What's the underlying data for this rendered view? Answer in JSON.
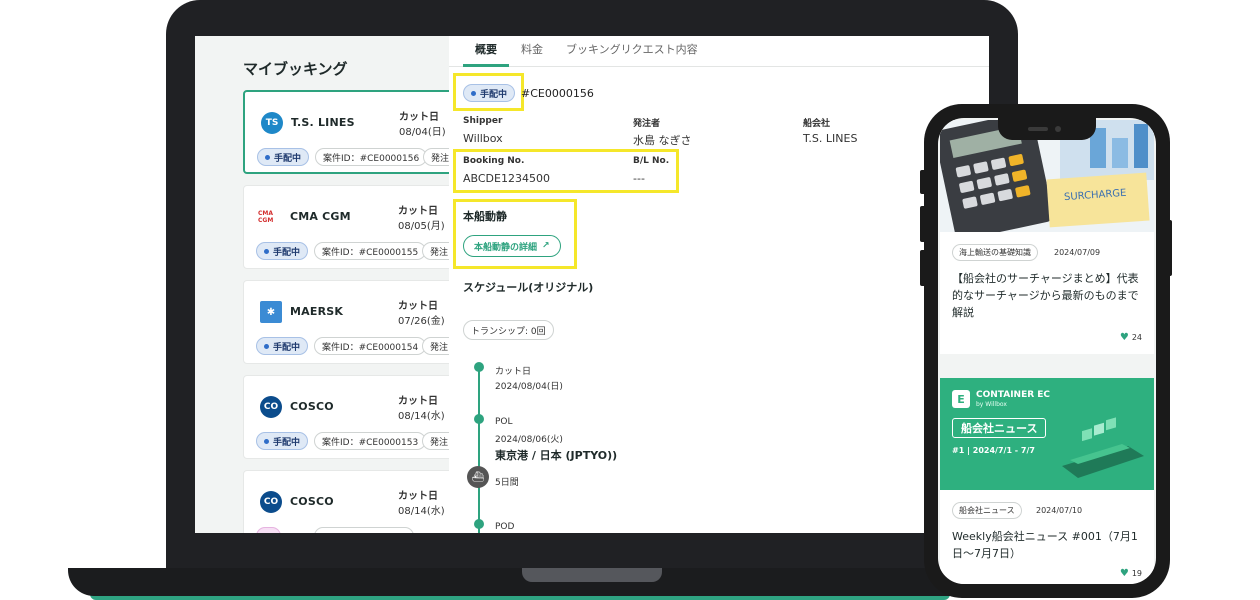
{
  "list": {
    "title": "マイブッキング",
    "cut_label": "カット日",
    "status_label": "手配中",
    "more_chip": "発注",
    "cards": [
      {
        "logo": "TS",
        "name": "T.S. LINES",
        "cut_date": "08/04(日)",
        "case_id": "案件ID：#CE0000156"
      },
      {
        "logo": "CMA CGM",
        "name": "CMA CGM",
        "cut_date": "08/05(月)",
        "case_id": "案件ID：#CE0000155"
      },
      {
        "logo": "✱",
        "name": "MAERSK",
        "cut_date": "07/26(金)",
        "case_id": "案件ID：#CE0000154"
      },
      {
        "logo": "CO",
        "name": "COSCO",
        "cut_date": "08/14(水)",
        "case_id": "案件ID：#CE0000153"
      },
      {
        "logo": "CO",
        "name": "COSCO",
        "cut_date": "08/14(水)",
        "case_id": ""
      }
    ]
  },
  "detail": {
    "tabs": [
      "概要",
      "料金",
      "ブッキングリクエスト内容"
    ],
    "status": "手配中",
    "booking_id": "#CE0000156",
    "fields": {
      "shipper_label": "Shipper",
      "shipper_value": "Willbox",
      "orderer_label": "発注者",
      "orderer_value": "水島 なぎさ",
      "carrier_label": "船会社",
      "carrier_value": "T.S. LINES",
      "booking_no_label": "Booking No.",
      "booking_no_value": "ABCDE1234500",
      "bl_no_label": "B/L No.",
      "bl_no_value": "---"
    },
    "vessel_title": "本船動静",
    "vessel_button": "本船動静の詳細",
    "schedule_title": "スケジュール(オリジナル)",
    "transship": "トランシップ: 0回",
    "timeline": {
      "cut_label": "カット日",
      "cut_date": "2024/08/04(日)",
      "pol_label": "POL",
      "pol_date": "2024/08/06(火)",
      "pol_port": "東京港 / 日本 (JPTYO))",
      "duration": "5日間",
      "pod_label": "POD"
    }
  },
  "phone": {
    "articles": [
      {
        "image_text": "SURCHARGE",
        "tag": "海上輸送の基礎知識",
        "date": "2024/07/09",
        "title": "【船会社のサーチャージまとめ】代表的なサーチャージから最新のものまで解説",
        "likes": "24"
      },
      {
        "banner_brand": "CONTAINER EC",
        "banner_sub": "by Willbox",
        "banner_title": "船会社ニュース",
        "banner_period": "#1 | 2024/7/1 - 7/7",
        "tag": "船会社ニュース",
        "date": "2024/07/10",
        "title": "Weekly船会社ニュース #001（7月1日〜7月7日）",
        "likes": "19"
      }
    ]
  },
  "colors": {
    "accent": "#2ea37f",
    "highlight": "#f5e72a",
    "status_blue": "#2f6dc8"
  }
}
